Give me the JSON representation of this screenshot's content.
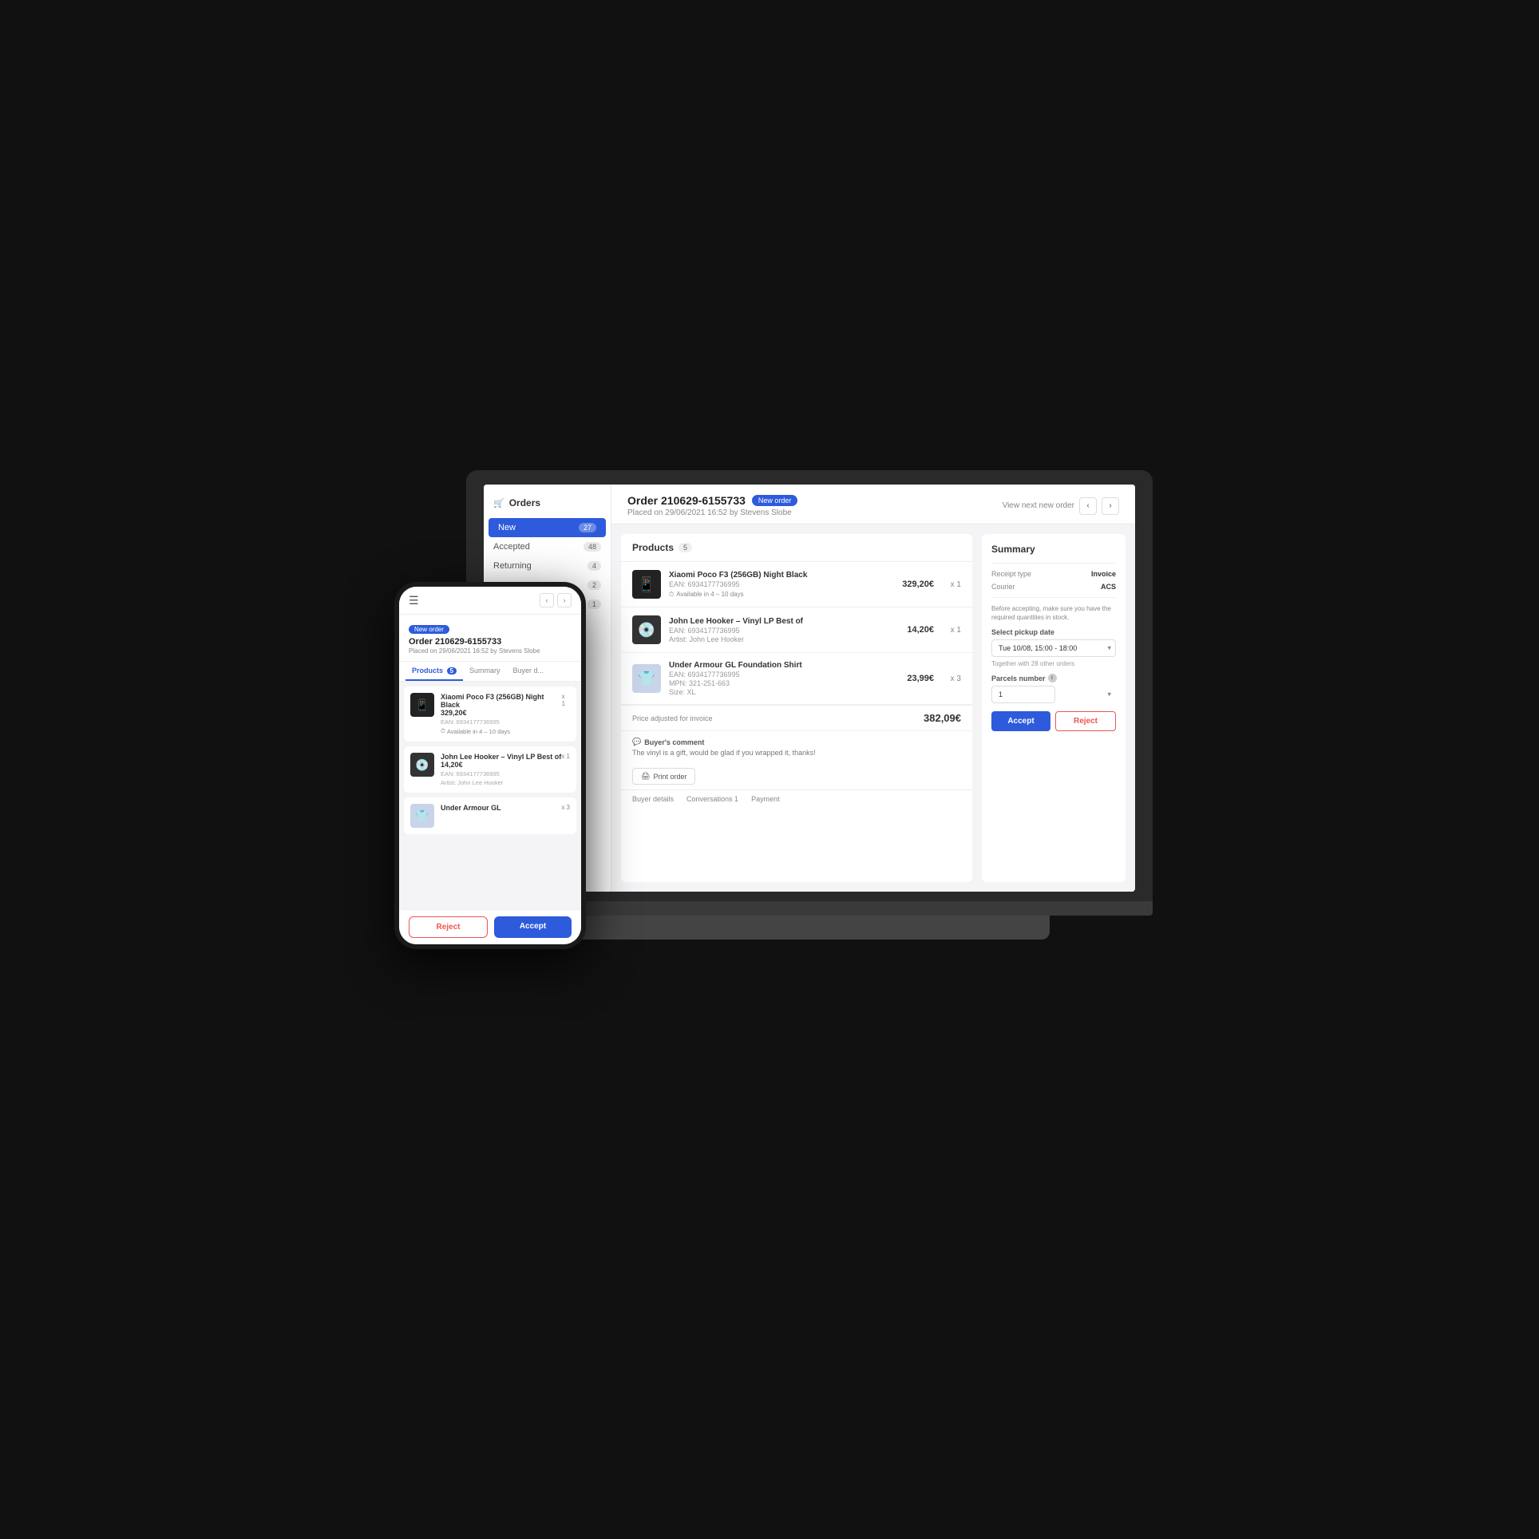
{
  "laptop": {
    "sidebar": {
      "title": "Orders",
      "items": [
        {
          "label": "New",
          "count": "27",
          "active": true
        },
        {
          "label": "Accepted",
          "count": "48",
          "active": false
        },
        {
          "label": "Returning",
          "count": "4",
          "active": false
        },
        {
          "label": "",
          "count": "2",
          "active": false
        },
        {
          "label": "",
          "count": "1",
          "active": false
        }
      ]
    },
    "order": {
      "number": "Order 210629-6155733",
      "badge": "New order",
      "meta": "Placed on 29/06/2021 16:52 by Stevens Slobe",
      "view_next_label": "View next new order"
    },
    "products": {
      "title": "Products",
      "count": "5",
      "items": [
        {
          "name": "Xiaomi Poco F3 (256GB) Night Black",
          "ean": "EAN: 6934177736995",
          "availability": "Available in 4 – 10 days",
          "price": "329,20€",
          "qty": "x 1",
          "img_type": "phone"
        },
        {
          "name": "John Lee Hooker – Vinyl LP Best of",
          "ean": "EAN: 6934177736995",
          "artist": "Artist: John Lee Hooker",
          "price": "14,20€",
          "qty": "x 1",
          "img_type": "vinyl"
        },
        {
          "name": "Under Armour GL Foundation Shirt",
          "ean": "EAN: 6934177736995",
          "mpn": "MPN: 321-251-663",
          "size": "Size: XL",
          "price": "23,99€",
          "qty": "x 3",
          "img_type": "shirt"
        }
      ],
      "price_adj_label": "Price adjusted for invoice",
      "price_total": "382,09€",
      "buyer_comment_label": "Buyer's comment",
      "buyer_comment_text": "The vinyl is a gift, would be glad if you wrapped it, thanks!",
      "print_label": "Print order",
      "bottom_tabs": [
        "Buyer details",
        "Conversations 1",
        "Payment"
      ]
    },
    "summary": {
      "title": "Summary",
      "receipt_label": "Receipt type",
      "receipt_value": "Invoice",
      "courier_label": "Courier",
      "courier_value": "ACS",
      "note": "Before accepting, make sure you have the required quantities in stock.",
      "pickup_label": "Select pickup date",
      "pickup_value": "Tue 10/08, 15:00 - 18:00",
      "together_note": "Together with 28 other orders",
      "parcels_label": "Parcels number",
      "parcels_value": "1",
      "accept_label": "Accept",
      "reject_label": "Reject"
    }
  },
  "mobile": {
    "order": {
      "badge": "New order",
      "number": "Order 210629-6155733",
      "meta": "Placed on 29/06/2021 16:52 by Stevens Slobe"
    },
    "tabs": [
      {
        "label": "Products",
        "count": "5",
        "active": true
      },
      {
        "label": "Summary",
        "active": false
      },
      {
        "label": "Buyer d...",
        "active": false
      }
    ],
    "products": [
      {
        "name": "Xiaomi Poco F3 (256GB) Night Black",
        "qty": "x 1",
        "price": "329,20€",
        "ean": "EAN: 6934177736995",
        "availability": "Available in 4 – 10 days",
        "img_type": "phone"
      },
      {
        "name": "John Lee Hooker – Vinyl LP Best of",
        "qty": "x 1",
        "price": "14,20€",
        "ean": "EAN: 6934177736995",
        "artist": "Artist: John Lee Hooker",
        "img_type": "vinyl"
      },
      {
        "name": "Under Armour GL",
        "qty": "x 3",
        "price": "",
        "img_type": "shirt"
      }
    ],
    "accept_label": "Accept",
    "reject_label": "Reject"
  }
}
